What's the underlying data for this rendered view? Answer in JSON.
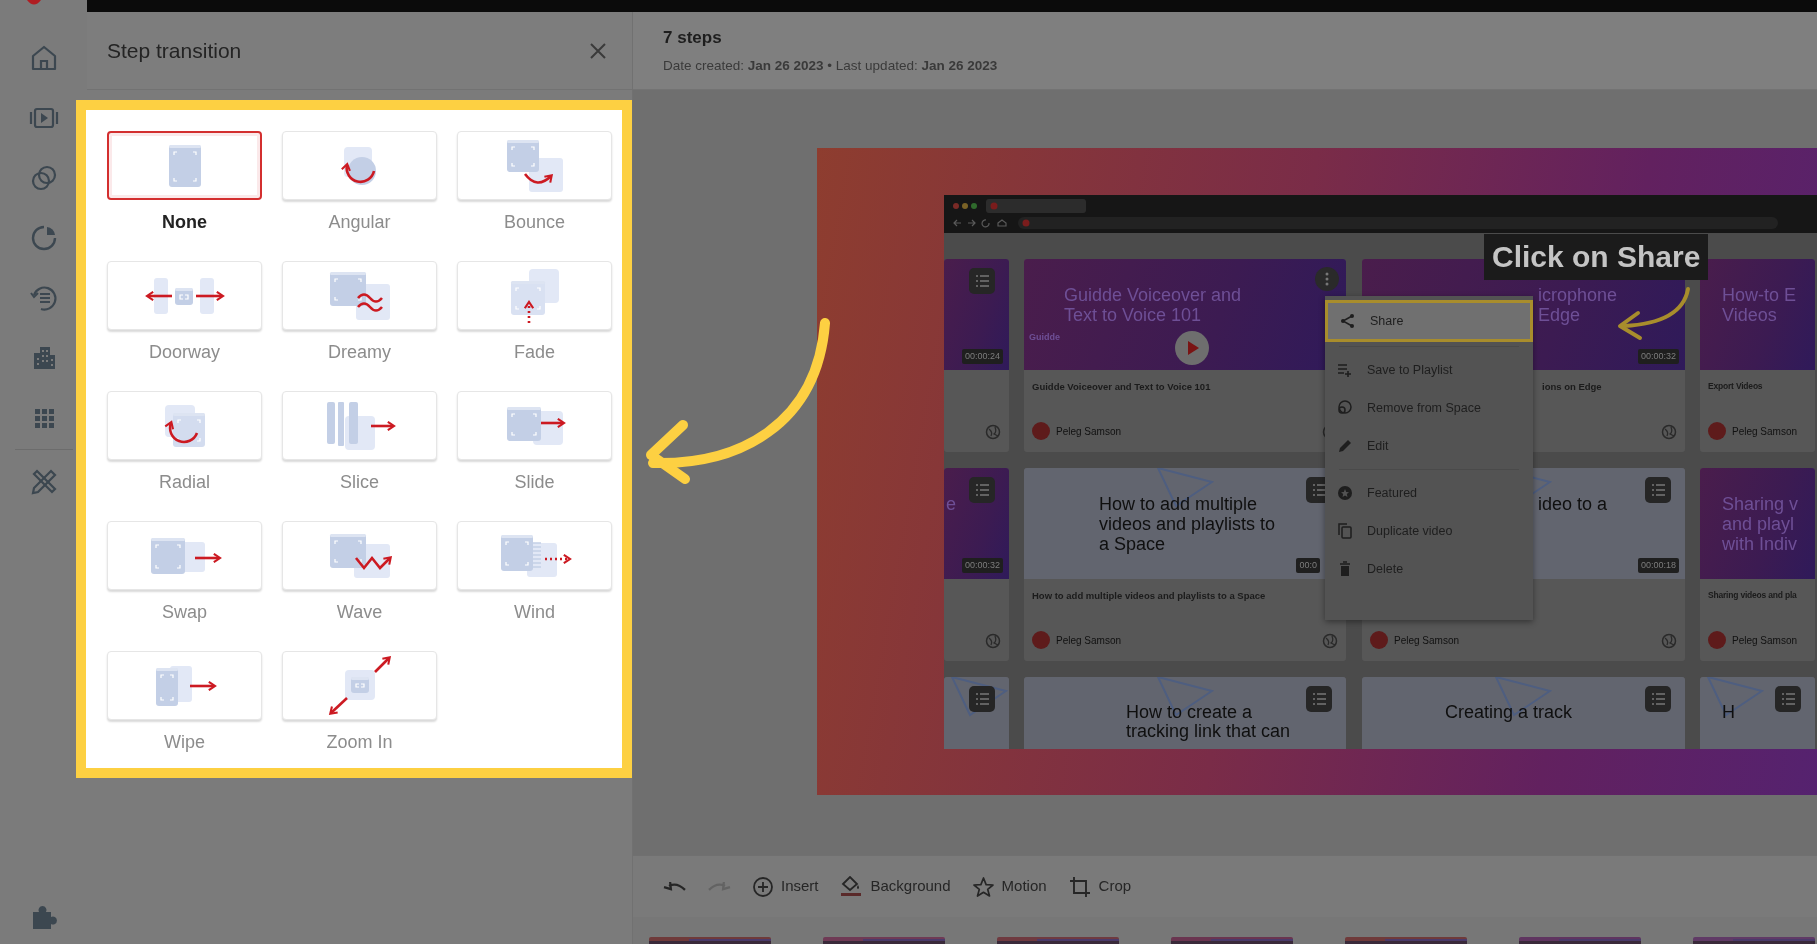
{
  "panel": {
    "title": "Step transition",
    "transitions": [
      {
        "kind": "none",
        "label": "None",
        "selected": true
      },
      {
        "kind": "angular",
        "label": "Angular",
        "selected": false
      },
      {
        "kind": "bounce",
        "label": "Bounce",
        "selected": false
      },
      {
        "kind": "doorway",
        "label": "Doorway",
        "selected": false
      },
      {
        "kind": "dreamy",
        "label": "Dreamy",
        "selected": false
      },
      {
        "kind": "fade",
        "label": "Fade",
        "selected": false
      },
      {
        "kind": "radial",
        "label": "Radial",
        "selected": false
      },
      {
        "kind": "slice",
        "label": "Slice",
        "selected": false
      },
      {
        "kind": "slide",
        "label": "Slide",
        "selected": false
      },
      {
        "kind": "swap",
        "label": "Swap",
        "selected": false
      },
      {
        "kind": "wave",
        "label": "Wave",
        "selected": false
      },
      {
        "kind": "wind",
        "label": "Wind",
        "selected": false
      },
      {
        "kind": "wipe",
        "label": "Wipe",
        "selected": false
      },
      {
        "kind": "zoom",
        "label": "Zoom In",
        "selected": false
      }
    ]
  },
  "header": {
    "title": "7 steps",
    "meta": "Date created: **Jan 26 2023** • Last updated: **Jan 26 2023**"
  },
  "preview": {
    "caption": "Click on Share",
    "cards": [
      {
        "kind": "dark",
        "duration": "00:00:24"
      },
      {
        "kind": "dark",
        "thumb_lines": [
          "Guidde Voiceover and",
          "Text to Voice 101"
        ],
        "brand": "Guidde",
        "play": true,
        "menu_open": true,
        "title": "Guidde Voiceover and Text to Voice 101",
        "author": "Peleg Samson"
      },
      {
        "kind": "dark",
        "thumb_lines": [
          "icrophone",
          "Edge"
        ],
        "duration": "00:00:32",
        "title": "ions on Edge"
      },
      {
        "kind": "dark",
        "thumb_lines": [
          "How-to E",
          "Videos"
        ],
        "title": "Export Videos",
        "author": "Peleg Samson"
      },
      {
        "kind": "dark",
        "thumb_lines": [
          "e"
        ],
        "duration": "00:00:32"
      },
      {
        "kind": "light",
        "thumb_lines": [
          "How to add multiple",
          "videos and playlists to",
          "a Space"
        ],
        "duration": "00:0",
        "title": "How to add multiple videos and playlists to a Space",
        "author": "Peleg Samson"
      },
      {
        "kind": "light",
        "thumb_lines": [
          "ideo to a"
        ],
        "duration": "00:00:18",
        "author": "Peleg Samson"
      },
      {
        "kind": "dark",
        "thumb_lines": [
          "Sharing v",
          "and playl",
          "with Indiv"
        ],
        "title": "Sharing videos and pla",
        "author": "Peleg Samson"
      },
      {
        "kind": "light"
      },
      {
        "kind": "light",
        "thumb_lines": [
          "How to create a",
          "tracking link that can"
        ]
      },
      {
        "kind": "light",
        "thumb_lines": [
          "Creating a track"
        ]
      },
      {
        "kind": "light",
        "thumb_lines": [
          "H"
        ]
      }
    ],
    "menu": [
      [
        {
          "kind": "share",
          "label": "Share",
          "selected": true
        }
      ],
      [
        {
          "kind": "playlist",
          "label": "Save to Playlist",
          "selected": false
        },
        {
          "kind": "remove",
          "label": "Remove from Space",
          "selected": false
        },
        {
          "kind": "edit",
          "label": "Edit",
          "selected": false
        }
      ],
      [
        {
          "kind": "featured",
          "label": "Featured",
          "selected": false
        },
        {
          "kind": "duplicate",
          "label": "Duplicate video",
          "selected": false
        },
        {
          "kind": "delete",
          "label": "Delete",
          "selected": false
        }
      ]
    ]
  },
  "toolbar": [
    {
      "kind": "undo",
      "disabled": false
    },
    {
      "kind": "redo",
      "disabled": true
    },
    {
      "kind": "insert",
      "label": "Insert",
      "disabled": false
    },
    {
      "kind": "background",
      "label": "Background",
      "disabled": false
    },
    {
      "kind": "motion",
      "label": "Motion",
      "disabled": false
    },
    {
      "kind": "crop",
      "label": "Crop",
      "disabled": false
    }
  ]
}
